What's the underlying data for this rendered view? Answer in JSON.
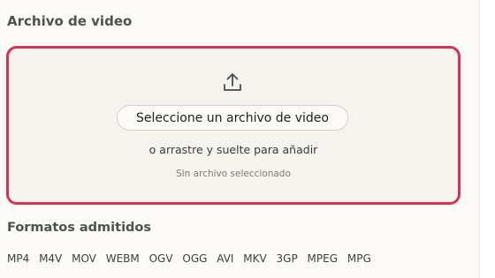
{
  "section_title": "Archivo de video",
  "dropzone": {
    "icon": "upload-icon",
    "select_label": "Seleccione un archivo de video",
    "drag_text": "o arrastre y suelte para añadir",
    "no_file_text": "Sin archivo seleccionado",
    "border_color": "#d9314f"
  },
  "formats": {
    "title": "Formatos admitidos",
    "items": [
      "MP4",
      "M4V",
      "MOV",
      "WEBM",
      "OGV",
      "OGG",
      "AVI",
      "MKV",
      "3GP",
      "MPEG",
      "MPG"
    ]
  }
}
